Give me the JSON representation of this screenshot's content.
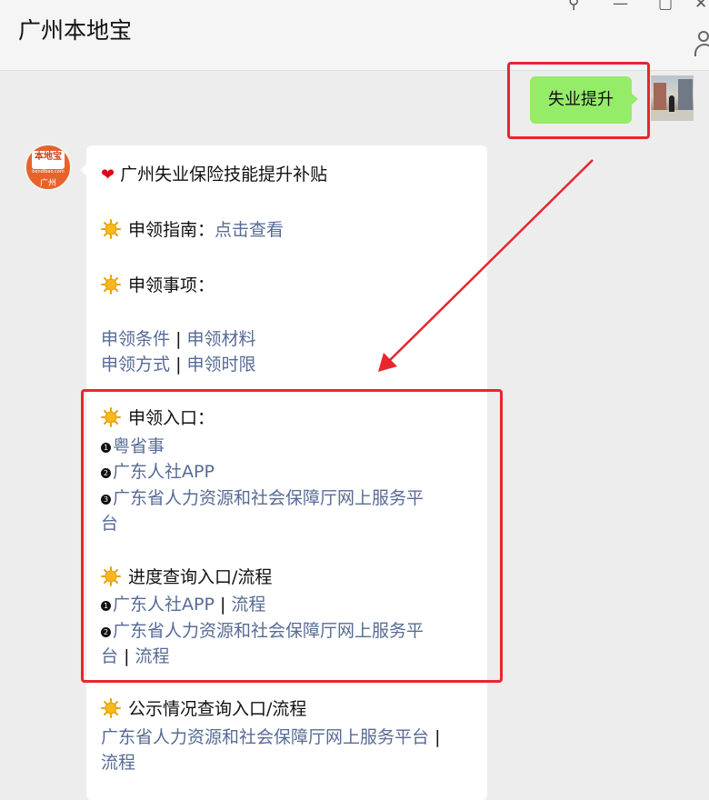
{
  "window": {
    "title": "广州本地宝"
  },
  "user_message": {
    "text": "失业提升"
  },
  "bot_avatar": {
    "logo_text": "本地宝",
    "logo_url": "bendibao.com",
    "logo_city": "广州"
  },
  "bot_message": {
    "headline": "广州失业保险技能提升补贴",
    "guide_label": "申领指南：",
    "guide_link": "点击查看",
    "items_label": "申领事项：",
    "item_links": [
      "申领条件",
      "申领材料",
      "申领方式",
      "申领时限"
    ],
    "separator": "|",
    "entry_label": "申领入口：",
    "entries": [
      {
        "num": "1",
        "text": "粤省事"
      },
      {
        "num": "2",
        "text": "广东人社APP"
      },
      {
        "num": "3",
        "text": "广东省人力资源和社会保障厅网上服务平",
        "cont": "台"
      }
    ],
    "progress_label": "进度查询入口/流程",
    "progress_entries": [
      {
        "num": "1",
        "text": "广东人社APP",
        "sep": "|",
        "flow": "流程"
      },
      {
        "num": "2",
        "text": "广东省人力资源和社会保障厅网上服务平",
        "cont": "台",
        "sep": "|",
        "flow": "流程"
      }
    ],
    "public_label": "公示情况查询入口/流程",
    "public_link": "广东省人力资源和社会保障厅网上服务平台",
    "public_sep": "|",
    "public_flow": "流程"
  },
  "colors": {
    "user_bubble": "#95ec69",
    "link": "#576b95",
    "highlight": "#e8262d"
  },
  "icons": [
    "pin-icon",
    "minimize-icon",
    "maximize-icon",
    "close-icon",
    "person-icon",
    "heart-icon",
    "sun-icon"
  ]
}
